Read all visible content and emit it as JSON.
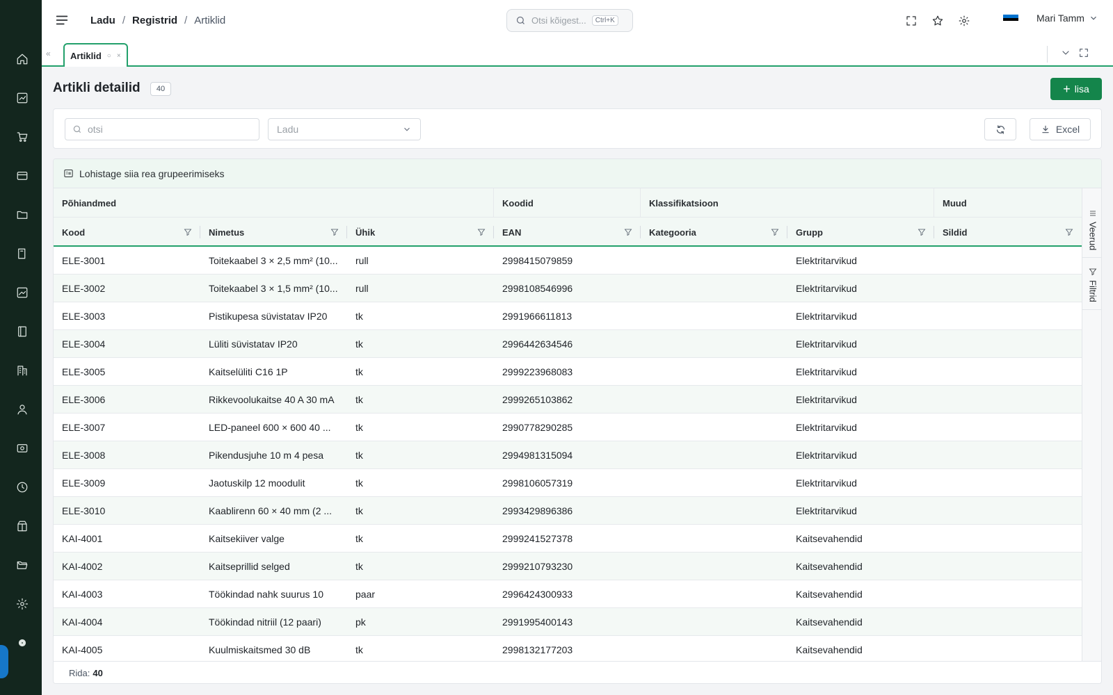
{
  "colors": {
    "rail_bg": "#13261e",
    "accent": "#22a06b",
    "primary_button": "#14854b",
    "alt_row": "#f4f9f6"
  },
  "rail": {
    "icons": [
      "home-icon",
      "chart-line-icon",
      "cart-icon",
      "credit-card-icon",
      "folder-icon",
      "book-icon",
      "trend-icon",
      "ledger-icon",
      "building-icon",
      "user-icon",
      "cash-icon",
      "clock-icon",
      "package-icon",
      "folder-open-icon",
      "settings-icon",
      "admin-gear-icon"
    ]
  },
  "header": {
    "breadcrumb": [
      "Ladu",
      "Registrid",
      "Artiklid"
    ],
    "search_placeholder": "Otsi kõigest...",
    "search_shortcut": "Ctrl+K",
    "user_name": "Mari Tamm",
    "flag_colors": [
      "#0072ce",
      "#000000",
      "#ffffff"
    ]
  },
  "tabs": [
    {
      "label": "Artiklid",
      "active": true
    }
  ],
  "page": {
    "title": "Artikli detailid",
    "count": "40",
    "add_label": "lisa"
  },
  "filters": {
    "search_placeholder": "otsi",
    "warehouse_placeholder": "Ladu",
    "excel_label": "Excel"
  },
  "grid": {
    "group_drop_text": "Lohistage siia rea grupeerimiseks",
    "column_groups": [
      {
        "label": "Põhiandmed"
      },
      {
        "label": "Koodid"
      },
      {
        "label": "Klassifikatsioon"
      },
      {
        "label": "Muud"
      }
    ],
    "columns": [
      {
        "label": "Kood"
      },
      {
        "label": "Nimetus"
      },
      {
        "label": "Ühik"
      },
      {
        "label": "EAN"
      },
      {
        "label": "Kategooria"
      },
      {
        "label": "Grupp"
      },
      {
        "label": "Sildid"
      }
    ],
    "rows": [
      [
        "ELE-3001",
        "Toitekaabel 3 × 2,5 mm² (10...",
        "rull",
        "2998415079859",
        "",
        "Elektritarvikud",
        ""
      ],
      [
        "ELE-3002",
        "Toitekaabel 3 × 1,5 mm² (10...",
        "rull",
        "2998108546996",
        "",
        "Elektritarvikud",
        ""
      ],
      [
        "ELE-3003",
        "Pistikupesa süvistatav IP20",
        "tk",
        "2991966611813",
        "",
        "Elektritarvikud",
        ""
      ],
      [
        "ELE-3004",
        "Lüliti süvistatav IP20",
        "tk",
        "2996442634546",
        "",
        "Elektritarvikud",
        ""
      ],
      [
        "ELE-3005",
        "Kaitselüliti C16 1P",
        "tk",
        "2999223968083",
        "",
        "Elektritarvikud",
        ""
      ],
      [
        "ELE-3006",
        "Rikkevoolukaitse 40 A 30 mA",
        "tk",
        "2999265103862",
        "",
        "Elektritarvikud",
        ""
      ],
      [
        "ELE-3007",
        "LED-paneel 600 × 600 40 ...",
        "tk",
        "2990778290285",
        "",
        "Elektritarvikud",
        ""
      ],
      [
        "ELE-3008",
        "Pikendusjuhe 10 m 4 pesa",
        "tk",
        "2994981315094",
        "",
        "Elektritarvikud",
        ""
      ],
      [
        "ELE-3009",
        "Jaotuskilp 12 moodulit",
        "tk",
        "2998106057319",
        "",
        "Elektritarvikud",
        ""
      ],
      [
        "ELE-3010",
        "Kaablirenn 60 × 40 mm (2 ...",
        "tk",
        "2993429896386",
        "",
        "Elektritarvikud",
        ""
      ],
      [
        "KAI-4001",
        "Kaitsekiiver valge",
        "tk",
        "2999241527378",
        "",
        "Kaitsevahendid",
        ""
      ],
      [
        "KAI-4002",
        "Kaitseprillid selged",
        "tk",
        "2999210793230",
        "",
        "Kaitsevahendid",
        ""
      ],
      [
        "KAI-4003",
        "Töökindad nahk suurus 10",
        "paar",
        "2996424300933",
        "",
        "Kaitsevahendid",
        ""
      ],
      [
        "KAI-4004",
        "Töökindad nitriil (12 paari)",
        "pk",
        "2991995400143",
        "",
        "Kaitsevahendid",
        ""
      ],
      [
        "KAI-4005",
        "Kuulmiskaitsmed 30 dB",
        "tk",
        "2998132177203",
        "",
        "Kaitsevahendid",
        ""
      ]
    ],
    "side_panel": {
      "columns_label": "Veerud",
      "filters_label": "Filtrid"
    },
    "footer": {
      "rows_label": "Rida:",
      "rows_count": "40"
    }
  }
}
